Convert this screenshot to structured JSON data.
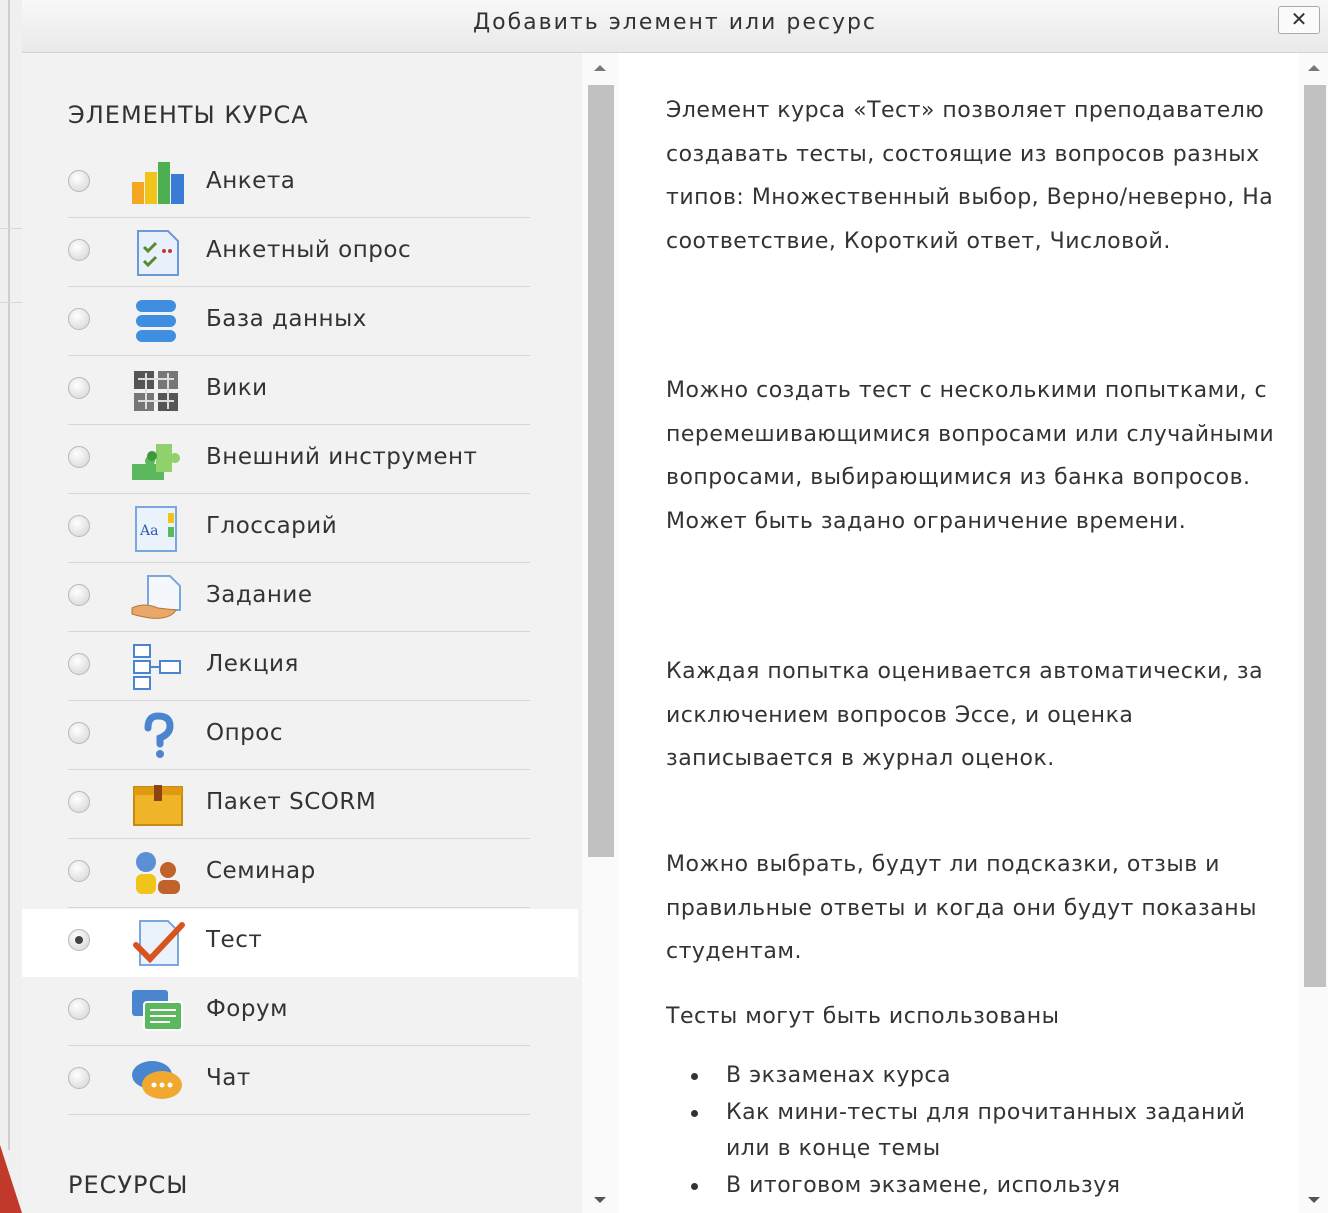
{
  "dialog": {
    "title": "Добавить элемент или ресурс",
    "close_label": "✕"
  },
  "activities_header": "ЭЛЕМЕНТЫ КУРСА",
  "resources_header": "РЕСУРСЫ",
  "activities": [
    {
      "label": "Анкета",
      "icon": "feedback-bar-chart-icon",
      "selected": false
    },
    {
      "label": "Анкетный опрос",
      "icon": "survey-checklist-icon",
      "selected": false
    },
    {
      "label": "База данных",
      "icon": "database-icon",
      "selected": false
    },
    {
      "label": "Вики",
      "icon": "wiki-icon",
      "selected": false
    },
    {
      "label": "Внешний инструмент",
      "icon": "puzzle-external-tool-icon",
      "selected": false
    },
    {
      "label": "Глоссарий",
      "icon": "glossary-icon",
      "selected": false
    },
    {
      "label": "Задание",
      "icon": "assignment-icon",
      "selected": false
    },
    {
      "label": "Лекция",
      "icon": "lesson-flowchart-icon",
      "selected": false
    },
    {
      "label": "Опрос",
      "icon": "question-mark-icon",
      "selected": false
    },
    {
      "label": "Пакет SCORM",
      "icon": "scorm-package-icon",
      "selected": false
    },
    {
      "label": "Семинар",
      "icon": "workshop-people-icon",
      "selected": false
    },
    {
      "label": "Тест",
      "icon": "quiz-checkmark-icon",
      "selected": true
    },
    {
      "label": "Форум",
      "icon": "forum-icon",
      "selected": false
    },
    {
      "label": "Чат",
      "icon": "chat-bubble-icon",
      "selected": false
    }
  ],
  "description": {
    "p1": "Элемент курса «Тест» позволяет преподавателю создавать тесты, состоящие из вопросов разных типов: Множественный выбор, Верно/неверно, На соответствие, Короткий ответ, Числовой.",
    "p2": "Можно создать тест с несколькими попытками, с перемешивающимися вопросами или случайными вопросами, выбирающимися из банка вопросов. Может быть задано ограничение времени.",
    "p3": "Каждая попытка оценивается автоматически, за исключением вопросов Эссе, и оценка записывается в журнал оценок.",
    "p4": "Можно выбрать, будут ли подсказки, отзыв и правильные ответы и когда они будут показаны студентам.",
    "p5": "Тесты могут быть использованы",
    "bullets": [
      "В экзаменах курса",
      "Как мини-тесты для прочитанных заданий или в конце темы",
      "В итоговом экзамене, используя"
    ]
  },
  "colors": {
    "accent_selected_bg": "#ffffff",
    "pane_bg": "#f2f2f2",
    "text": "#333333"
  }
}
